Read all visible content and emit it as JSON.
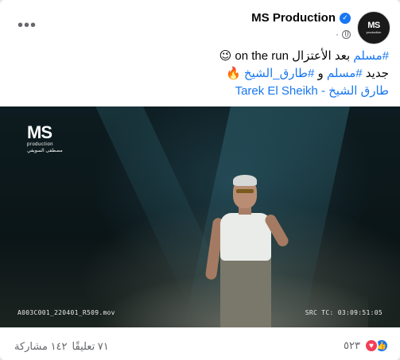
{
  "header": {
    "page_name": "MS Production",
    "verified_glyph": "✓",
    "meta_dot": "·",
    "more_label": "•••"
  },
  "avatar": {
    "logo_text": "MS",
    "logo_sub": "production"
  },
  "post": {
    "line1_hashtag": "#مسلم",
    "line1_text": " بعد الأعتزال on the run ",
    "line1_emoji": "😉",
    "line2_prefix": "جديد ",
    "line2_hashtag1": "#مسلم",
    "line2_mid": " و ",
    "line2_hashtag2": "#طارق_الشيخ",
    "line2_emoji": " 🔥",
    "link_text": "طارق الشيخ - Tarek El Sheikh"
  },
  "video": {
    "logo_mark": "MS",
    "logo_sub": "production",
    "logo_arabic": "مصطفى السويفي",
    "file_label": "A003C001_220401_R509.mov",
    "timecode_label": "SRC TC: 03:09:51:05"
  },
  "footer": {
    "reaction_count": "٥٢٣",
    "comments": "٧١ تعليقًا",
    "shares": "١٤٢ مشاركة"
  },
  "colors": {
    "accent": "#1877f2",
    "love": "#f33e58",
    "muted": "#65676b"
  },
  "icons": [
    "verified-icon",
    "globe-icon",
    "more-icon",
    "like-icon",
    "love-icon"
  ]
}
